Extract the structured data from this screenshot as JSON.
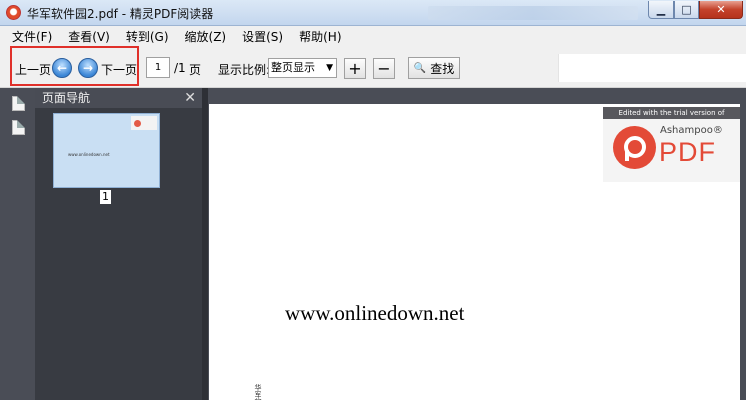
{
  "window": {
    "title": "华军软件园2.pdf - 精灵PDF阅读器",
    "minimize": "▁",
    "maximize": "□",
    "close": "✕"
  },
  "menu": [
    "文件(F)",
    "查看(V)",
    "转到(G)",
    "缩放(Z)",
    "设置(S)",
    "帮助(H)"
  ],
  "toolbar": {
    "prev_label": "上一页",
    "prev_icon": "←",
    "next_icon": "→",
    "next_label": "下一页",
    "page_value": "1",
    "page_total": "/1",
    "page_unit": "页",
    "zoom_label": "显示比例:",
    "zoom_value": "整页显示",
    "zoom_in": "+",
    "zoom_out": "−",
    "find_label": "查找",
    "find_icon": "🔍"
  },
  "nav_panel": {
    "title": "页面导航",
    "close": "✕",
    "thumbnail_text": "www.onlinedown.net",
    "page_number": "1"
  },
  "document": {
    "watermark_top": "Edited with the trial version of",
    "watermark_brand": "Ashampoo®",
    "watermark_pdf": "PDF",
    "main_text": "www.onlinedown.net",
    "vertical_text": "华军软件"
  },
  "colors": {
    "highlight_box": "#e0302a",
    "panel_dark": "#383b42",
    "watermark_red": "#e34a37"
  }
}
